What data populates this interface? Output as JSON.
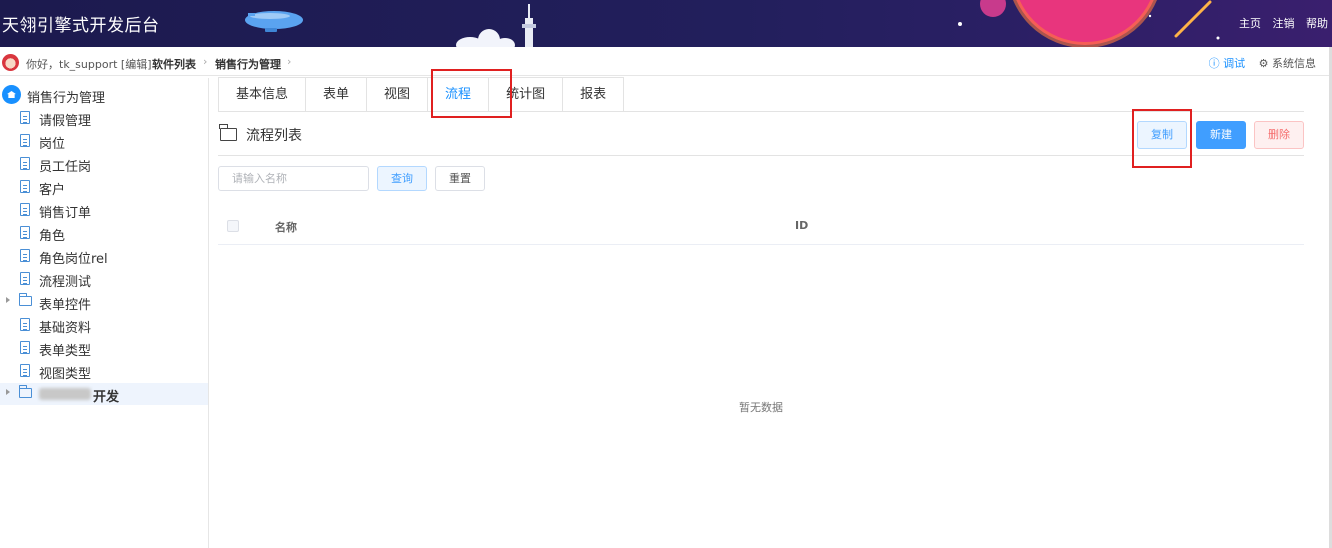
{
  "header": {
    "title": "天翎引擎式开发后台",
    "links": [
      "主页",
      "注销",
      "帮助"
    ],
    "gradient_colors": [
      "#1c1a4e",
      "#3a1f6e"
    ]
  },
  "subbar": {
    "greeting": "你好，tk_support [编辑]",
    "breadcrumb": [
      "软件列表",
      "销售行为管理"
    ],
    "debug": "调试",
    "system_info": "系统信息"
  },
  "sidebar": {
    "root": "销售行为管理",
    "items": [
      {
        "label": "请假管理",
        "type": "file"
      },
      {
        "label": "岗位",
        "type": "file"
      },
      {
        "label": "员工任岗",
        "type": "file"
      },
      {
        "label": "客户",
        "type": "file"
      },
      {
        "label": "销售订单",
        "type": "file"
      },
      {
        "label": "角色",
        "type": "file"
      },
      {
        "label": "角色岗位rel",
        "type": "file"
      },
      {
        "label": "流程测试",
        "type": "file"
      },
      {
        "label": "表单控件",
        "type": "folder"
      },
      {
        "label": "基础资料",
        "type": "file"
      },
      {
        "label": "表单类型",
        "type": "file"
      },
      {
        "label": "视图类型",
        "type": "file"
      },
      {
        "label": "开发",
        "type": "folder",
        "redacted": true
      }
    ]
  },
  "tabs": [
    "基本信息",
    "表单",
    "视图",
    "流程",
    "统计图",
    "报表"
  ],
  "active_tab": "流程",
  "list": {
    "title": "流程列表",
    "buttons": {
      "copy": "复制",
      "new": "新建",
      "delete": "删除"
    },
    "search_placeholder": "请输入名称",
    "query": "查询",
    "reset": "重置",
    "columns": [
      "名称",
      "ID"
    ],
    "empty_text": "暂无数据"
  },
  "colors": {
    "accent": "#409eff",
    "danger": "#f56c6c",
    "highlight": "#e02020"
  }
}
